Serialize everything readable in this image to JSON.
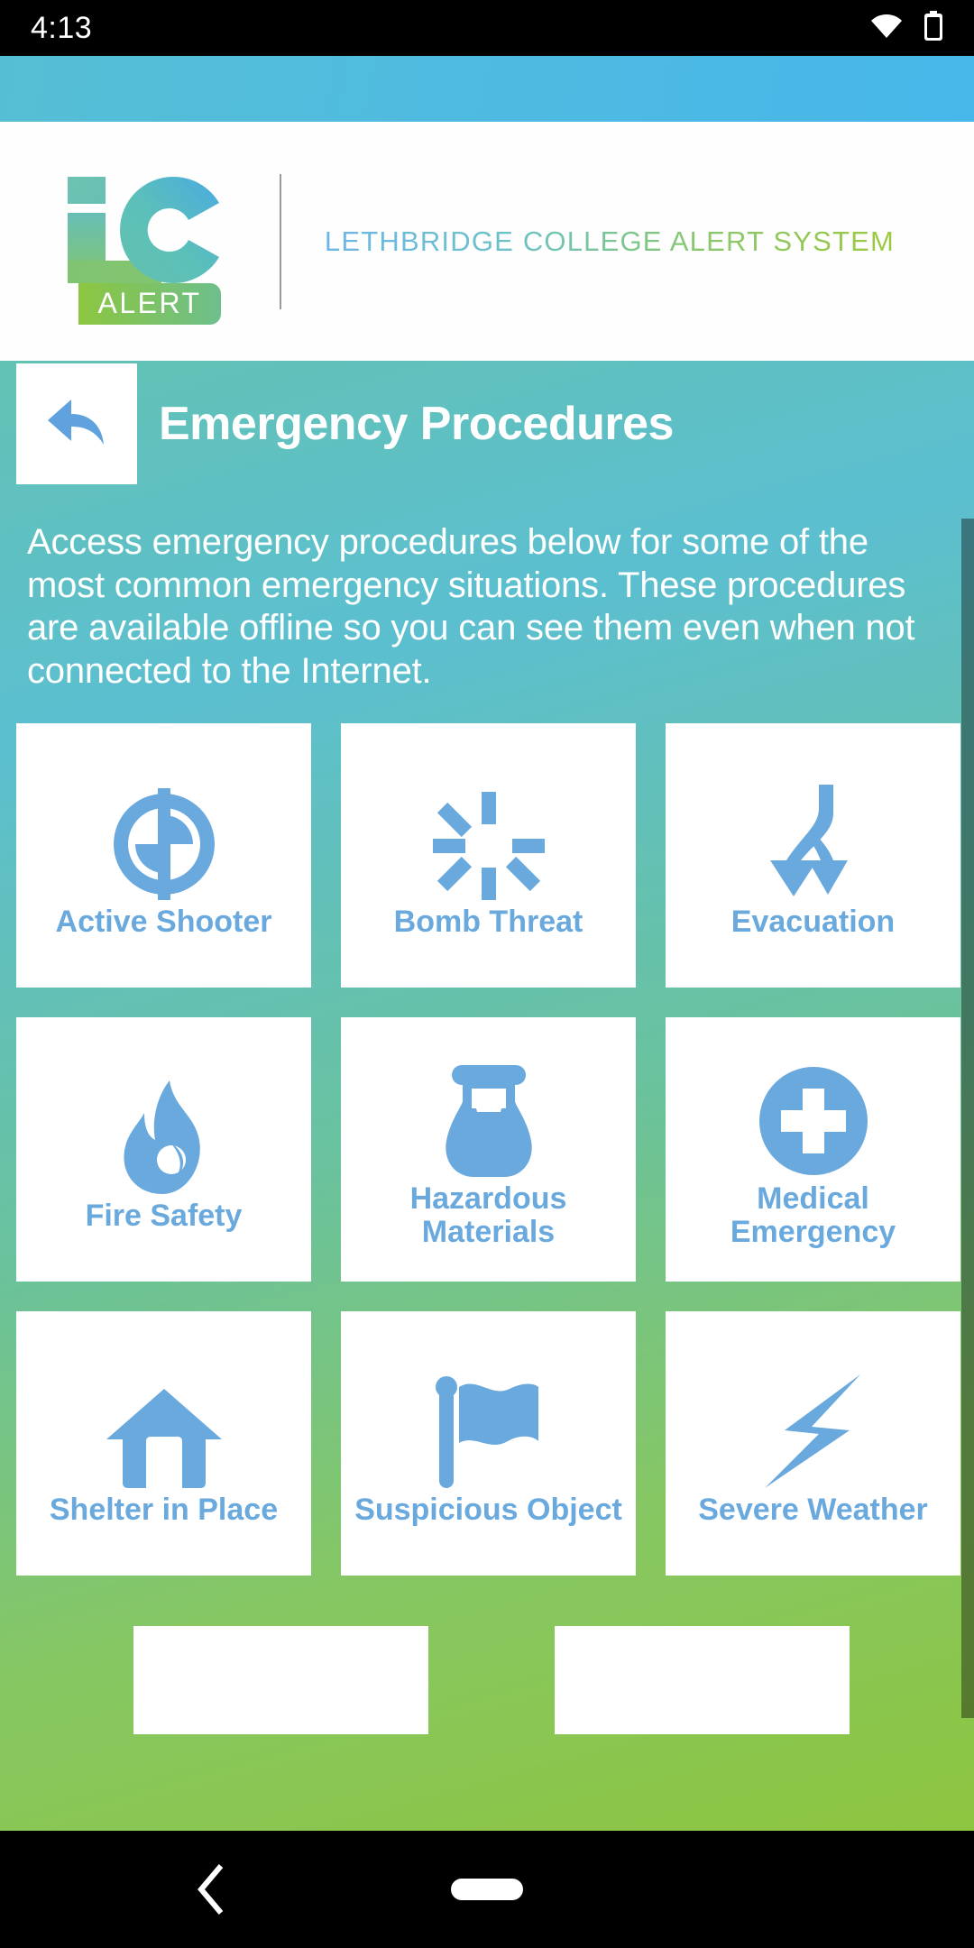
{
  "status_bar": {
    "time": "4:13",
    "wifi_icon": "wifi-icon",
    "battery_icon": "battery-icon"
  },
  "header": {
    "logo_text": "ALERT",
    "logo_letters": "LC",
    "title": "LETHBRIDGE COLLEGE ALERT SYSTEM",
    "divider": "vertical-divider"
  },
  "page": {
    "back_icon": "back-arrow-icon",
    "title": "Emergency Procedures",
    "description": "Access emergency procedures below for some of the most common emergency situations. These procedures are available offline so you can see them even when not connected to the Internet."
  },
  "grid": {
    "tiles": [
      {
        "label": "Active Shooter",
        "icon": "crosshair-target-icon"
      },
      {
        "label": "Bomb Threat",
        "icon": "explosion-burst-icon"
      },
      {
        "label": "Evacuation",
        "icon": "diverging-arrows-icon"
      },
      {
        "label": "Fire Safety",
        "icon": "flame-icon"
      },
      {
        "label": "Hazardous Materials",
        "icon": "chemical-flask-icon"
      },
      {
        "label": "Medical Emergency",
        "icon": "medical-cross-circle-icon"
      },
      {
        "label": "Shelter in Place",
        "icon": "house-icon"
      },
      {
        "label": "Suspicious Object",
        "icon": "flag-icon"
      },
      {
        "label": "Severe Weather",
        "icon": "lightning-bolt-icon"
      }
    ]
  },
  "nav_bar": {
    "back_icon": "nav-back-icon",
    "home_icon": "nav-home-pill"
  },
  "colors": {
    "icon_blue": "#6aa9dd",
    "brand_green": "#8cc63f",
    "brand_blue": "#4fbbe0",
    "tile_background": "#ffffff"
  }
}
